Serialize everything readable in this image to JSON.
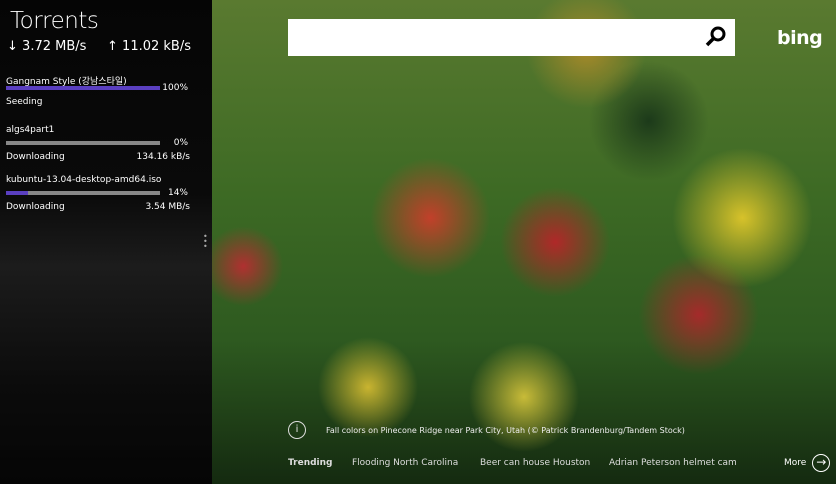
{
  "sidebar": {
    "title": "Torrents",
    "download_speed": "3.72 MB/s",
    "upload_speed": "11.02 kB/s",
    "torrents": [
      {
        "name": "Gangnam Style (강남스타일)",
        "percent_label": "100%",
        "progress": 100,
        "status": "Seeding",
        "rate": ""
      },
      {
        "name": "algs4part1",
        "percent_label": "0%",
        "progress": 0,
        "status": "Downloading",
        "rate": "134.16 kB/s"
      },
      {
        "name": "kubuntu-13.04-desktop-amd64.iso",
        "percent_label": "14%",
        "progress": 14,
        "status": "Downloading",
        "rate": "3.54 MB/s"
      }
    ]
  },
  "search": {
    "placeholder": ""
  },
  "brand": "bing",
  "caption": "Fall colors on Pinecone Ridge near Park City, Utah (© Patrick Brandenburg/Tandem Stock)",
  "trending": {
    "label": "Trending",
    "items": [
      "Flooding North Carolina",
      "Beer can house Houston",
      "Adrian Peterson helmet cam"
    ],
    "more": "More"
  },
  "colors": {
    "progress": "#5a3fc0",
    "track": "#888888"
  }
}
